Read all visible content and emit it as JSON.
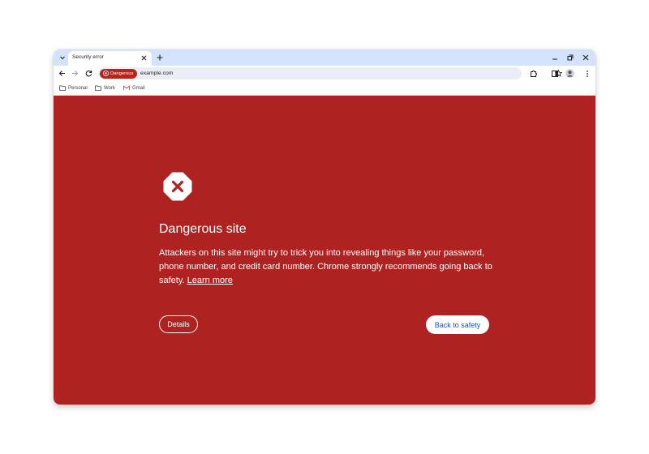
{
  "tab": {
    "title": "Security error"
  },
  "omnibox": {
    "chip_label": "Dangerous",
    "url": "example.com"
  },
  "bookmarks": [
    {
      "label": "Personal",
      "icon": "folder-icon"
    },
    {
      "label": "Work",
      "icon": "folder-icon"
    },
    {
      "label": "Gmail",
      "icon": "gmail-icon"
    }
  ],
  "interstitial": {
    "heading": "Dangerous site",
    "body": "Attackers on this site might try to trick you into revealing things like your password, phone number, and credit card number. Chrome strongly recommends going back to safety.",
    "learn_more": "Learn more",
    "details_button": "Details",
    "back_button": "Back to safety"
  },
  "colors": {
    "danger_background": "#ae2221",
    "chip_background": "#b3261e",
    "tabstrip": "#d3e3fd",
    "omnibox": "#e9eef6",
    "primary_button_text": "#0b57d0"
  }
}
